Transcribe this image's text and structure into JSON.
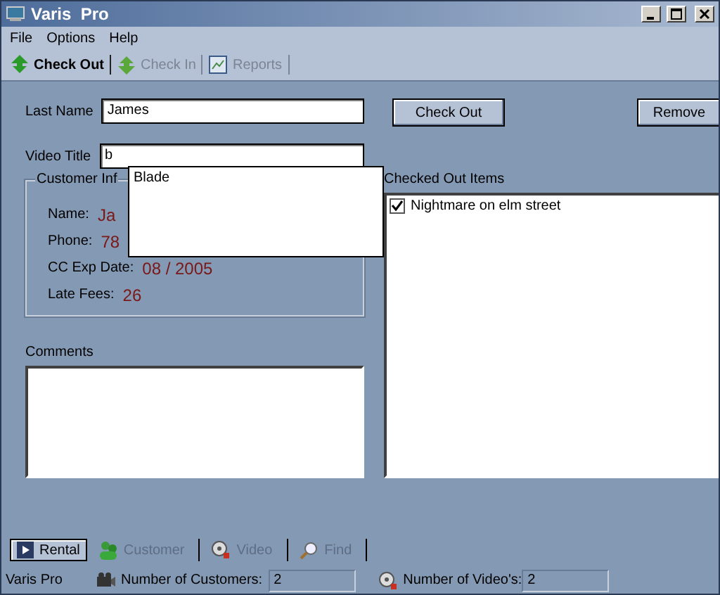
{
  "window": {
    "title": "Varis  Pro"
  },
  "menu": [
    "File",
    "Options",
    "Help"
  ],
  "tabs": [
    {
      "label": "Check Out",
      "selected": true
    },
    {
      "label": "Check In",
      "selected": false
    },
    {
      "label": "Reports",
      "selected": false
    }
  ],
  "form": {
    "last_name_label": "Last Name",
    "last_name": "James",
    "video_title_label": "Video Title",
    "video_title": "b",
    "suggestions": [
      "Blade"
    ],
    "customer_info": {
      "title": "Customer Inf",
      "rows": [
        {
          "label": "Name:",
          "value": "Ja"
        },
        {
          "label": "Phone:",
          "value": "78"
        },
        {
          "label": "CC Exp Date:",
          "value": "08 / 2005"
        },
        {
          "label": "Late Fees:",
          "value": "26"
        }
      ]
    },
    "comments_label": "Comments"
  },
  "buttons": [
    "Check Out",
    "Remove"
  ],
  "checked_out": {
    "title": "Checked Out Items",
    "items": [
      {
        "label": "Nightmare on elm street",
        "checked": true
      }
    ]
  },
  "bottom_tabs": [
    {
      "label": "Rental",
      "selected": true
    },
    {
      "label": "Customer",
      "selected": false
    },
    {
      "label": "Video",
      "selected": false
    },
    {
      "label": "Find",
      "selected": false
    }
  ],
  "status_bar": {
    "app": "Varis Pro",
    "customers_label": "Number of Customers:",
    "customers": "2",
    "videos_label": "Number of Video's:",
    "videos": "2"
  }
}
